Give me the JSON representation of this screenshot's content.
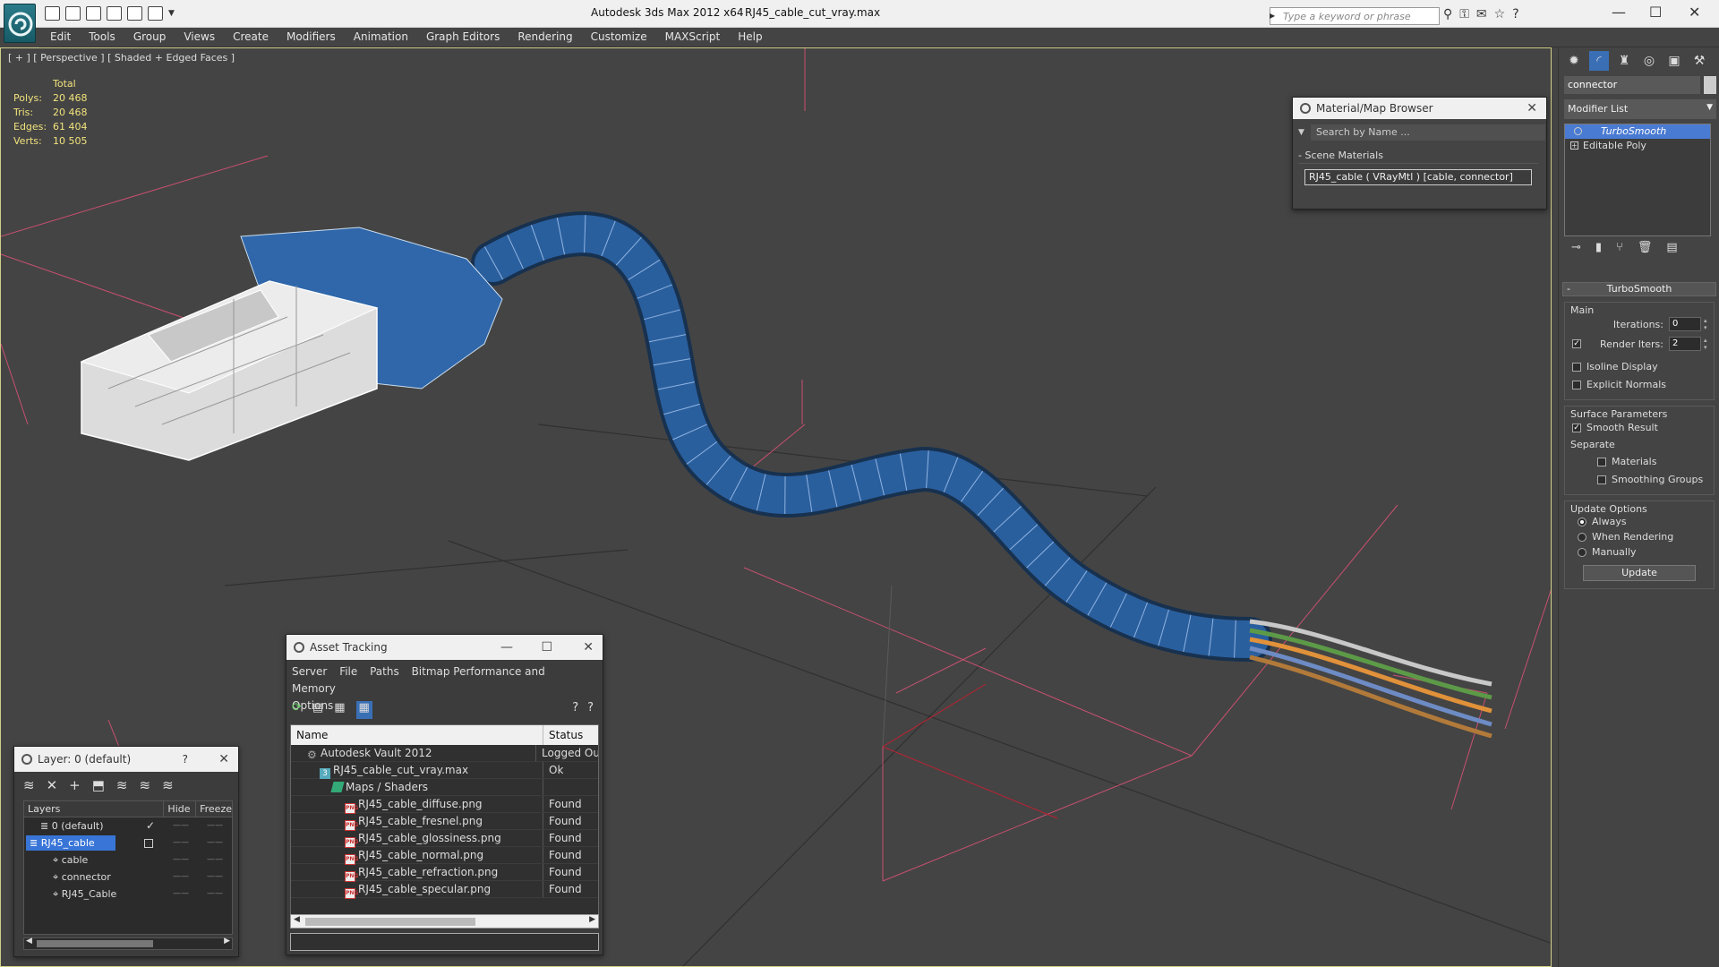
{
  "window": {
    "app_title": "Autodesk 3ds Max  2012 x64",
    "file_name": "RJ45_cable_cut_vray.max",
    "search_placeholder": "Type a keyword or phrase"
  },
  "menu": [
    "Edit",
    "Tools",
    "Group",
    "Views",
    "Create",
    "Modifiers",
    "Animation",
    "Graph Editors",
    "Rendering",
    "Customize",
    "MAXScript",
    "Help"
  ],
  "viewport": {
    "label": "[ + ] [ Perspective ] [ Shaded + Edged Faces ]",
    "stats_header": "Total",
    "stats": [
      {
        "label": "Polys:",
        "value": "20 468"
      },
      {
        "label": "Tris:",
        "value": "20 468"
      },
      {
        "label": "Edges:",
        "value": "61 404"
      },
      {
        "label": "Verts:",
        "value": "10 505"
      }
    ]
  },
  "material_browser": {
    "title": "Material/Map Browser",
    "search_placeholder": "Search by Name ...",
    "section": "Scene Materials",
    "item": "RJ45_cable  ( VRayMtl )  [cable, connector]"
  },
  "command_panel": {
    "object_name": "connector",
    "modifier_list": "Modifier List",
    "stack": [
      {
        "label": "TurboSmooth",
        "selected": true
      },
      {
        "label": "Editable Poly",
        "selected": false
      }
    ],
    "rollout_title": "TurboSmooth",
    "main_group": "Main",
    "iterations_label": "Iterations:",
    "iterations_value": "0",
    "render_iters_label": "Render Iters:",
    "render_iters_value": "2",
    "isoline_label": "Isoline Display",
    "explicit_normals_label": "Explicit Normals",
    "surface_group": "Surface Parameters",
    "smooth_result_label": "Smooth Result",
    "separate_label": "Separate",
    "materials_label": "Materials",
    "smoothing_groups_label": "Smoothing Groups",
    "update_group": "Update Options",
    "always_label": "Always",
    "when_rendering_label": "When Rendering",
    "manually_label": "Manually",
    "update_button": "Update"
  },
  "layer_panel": {
    "title": "Layer: 0 (default)",
    "help": "?",
    "col_layers": "Layers",
    "col_hide": "Hide",
    "col_freeze": "Freeze",
    "rows": [
      {
        "name": "0 (default)",
        "indent": 0,
        "selected": false
      },
      {
        "name": "RJ45_cable",
        "indent": 0,
        "selected": true
      },
      {
        "name": "cable",
        "indent": 1,
        "selected": false
      },
      {
        "name": "connector",
        "indent": 1,
        "selected": false
      },
      {
        "name": "RJ45_Cable",
        "indent": 1,
        "selected": false
      }
    ]
  },
  "asset_tracking": {
    "title": "Asset Tracking",
    "menu": [
      "Server",
      "File",
      "Paths",
      "Bitmap Performance and Memory",
      "Options"
    ],
    "col_name": "Name",
    "col_status": "Status",
    "rows": [
      {
        "name": "Autodesk Vault 2012",
        "status": "Logged Ou",
        "indent": 1,
        "icon": "vault-icon"
      },
      {
        "name": "RJ45_cable_cut_vray.max",
        "status": "Ok",
        "indent": 2,
        "icon": "max-file-icon"
      },
      {
        "name": "Maps / Shaders",
        "status": "",
        "indent": 3,
        "icon": "maps-folder-icon"
      },
      {
        "name": "RJ45_cable_diffuse.png",
        "status": "Found",
        "indent": 4,
        "icon": "png-icon"
      },
      {
        "name": "RJ45_cable_fresnel.png",
        "status": "Found",
        "indent": 4,
        "icon": "png-icon"
      },
      {
        "name": "RJ45_cable_glossiness.png",
        "status": "Found",
        "indent": 4,
        "icon": "png-icon"
      },
      {
        "name": "RJ45_cable_normal.png",
        "status": "Found",
        "indent": 4,
        "icon": "png-icon"
      },
      {
        "name": "RJ45_cable_refraction.png",
        "status": "Found",
        "indent": 4,
        "icon": "png-icon"
      },
      {
        "name": "RJ45_cable_specular.png",
        "status": "Found",
        "indent": 4,
        "icon": "png-icon"
      }
    ]
  },
  "colors": {
    "cable_blue": "#2a5f9e",
    "selection_blue": "#3875d7",
    "stats_yellow": "#f1e27b",
    "grid_pink": "#d05a7a"
  }
}
